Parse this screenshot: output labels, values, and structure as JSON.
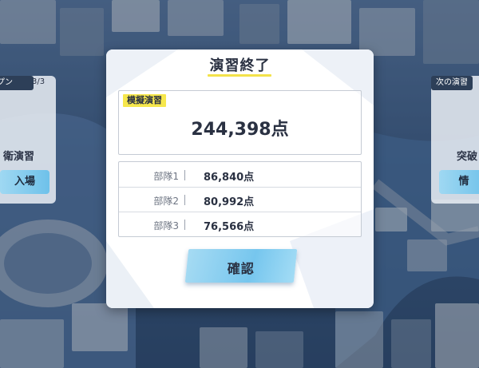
{
  "modal": {
    "title": "演習終了",
    "score_label": "模擬演習",
    "total_score": "244,398点",
    "teams": [
      {
        "name": "部隊1",
        "score": "86,840点"
      },
      {
        "name": "部隊2",
        "score": "80,992点"
      },
      {
        "name": "部隊3",
        "score": "76,566点"
      }
    ],
    "confirm_label": "確認"
  },
  "background": {
    "left_panel": {
      "tag": "プン",
      "counter": "3/3",
      "text": "衛演習",
      "button": "入場"
    },
    "right_panel": {
      "tag": "次の演習",
      "text": "突破",
      "button": "情"
    }
  },
  "colors": {
    "accent_yellow": "#f6e74c",
    "button_blue": "#76c6ee",
    "text_dark": "#2a3142"
  }
}
